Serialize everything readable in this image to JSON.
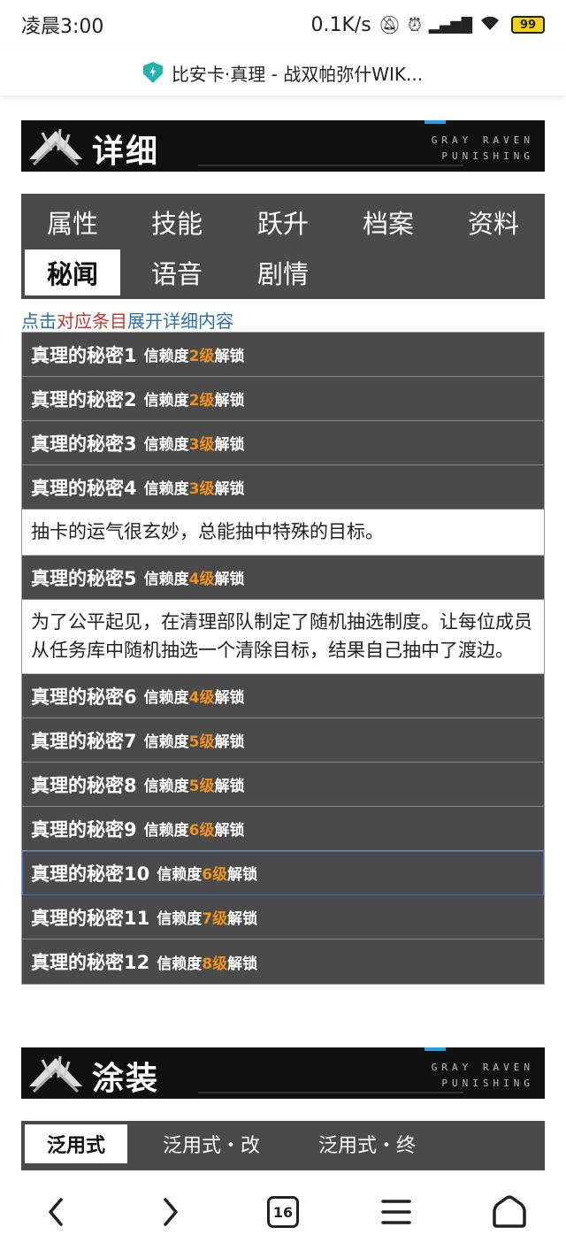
{
  "status": {
    "time": "凌晨3:00",
    "speed": "0.1K/s",
    "battery": "99"
  },
  "url": {
    "title": "比安卡·真理 - 战双帕弥什WIK..."
  },
  "detail_banner": {
    "title": "详细",
    "brand_line1": "GRAY RAVEN",
    "brand_line2": "PUNISHING"
  },
  "tabs": [
    "属性",
    "技能",
    "跃升",
    "档案",
    "资料",
    "秘闻",
    "语音",
    "剧情"
  ],
  "hint": {
    "part1": "点击",
    "part2": "对应条目",
    "part3": "展开详细内容"
  },
  "secrets": [
    {
      "name": "真理的秘密1",
      "unlock_prefix": "信赖度",
      "level": "2级",
      "unlock_suffix": "解锁"
    },
    {
      "name": "真理的秘密2",
      "unlock_prefix": "信赖度",
      "level": "2级",
      "unlock_suffix": "解锁"
    },
    {
      "name": "真理的秘密3",
      "unlock_prefix": "信赖度",
      "level": "3级",
      "unlock_suffix": "解锁"
    },
    {
      "name": "真理的秘密4",
      "unlock_prefix": "信赖度",
      "level": "3级",
      "unlock_suffix": "解锁",
      "detail": "抽卡的运气很玄妙，总能抽中特殊的目标。"
    },
    {
      "name": "真理的秘密5",
      "unlock_prefix": "信赖度",
      "level": "4级",
      "unlock_suffix": "解锁",
      "detail": "为了公平起见，在清理部队制定了随机抽选制度。让每位成员从任务库中随机抽选一个清除目标，结果自己抽中了渡边。"
    },
    {
      "name": "真理的秘密6",
      "unlock_prefix": "信赖度",
      "level": "4级",
      "unlock_suffix": "解锁"
    },
    {
      "name": "真理的秘密7",
      "unlock_prefix": "信赖度",
      "level": "5级",
      "unlock_suffix": "解锁"
    },
    {
      "name": "真理的秘密8",
      "unlock_prefix": "信赖度",
      "level": "5级",
      "unlock_suffix": "解锁"
    },
    {
      "name": "真理的秘密9",
      "unlock_prefix": "信赖度",
      "level": "6级",
      "unlock_suffix": "解锁"
    },
    {
      "name": "真理的秘密10",
      "unlock_prefix": "信赖度",
      "level": "6级",
      "unlock_suffix": "解锁"
    },
    {
      "name": "真理的秘密11",
      "unlock_prefix": "信赖度",
      "level": "7级",
      "unlock_suffix": "解锁"
    },
    {
      "name": "真理的秘密12",
      "unlock_prefix": "信赖度",
      "level": "8级",
      "unlock_suffix": "解锁"
    }
  ],
  "skin_banner": {
    "title": "涂装",
    "brand_line1": "GRAY RAVEN",
    "brand_line2": "PUNISHING"
  },
  "skin_tabs": [
    "泛用式",
    "泛用式・改",
    "泛用式・终"
  ],
  "nav": {
    "tab_count": "16"
  },
  "colors": {
    "panel": "#4a4a4a",
    "level_accent": "#f0921e",
    "hint_blue": "#2a6fb0",
    "hint_red": "#c0392b"
  }
}
